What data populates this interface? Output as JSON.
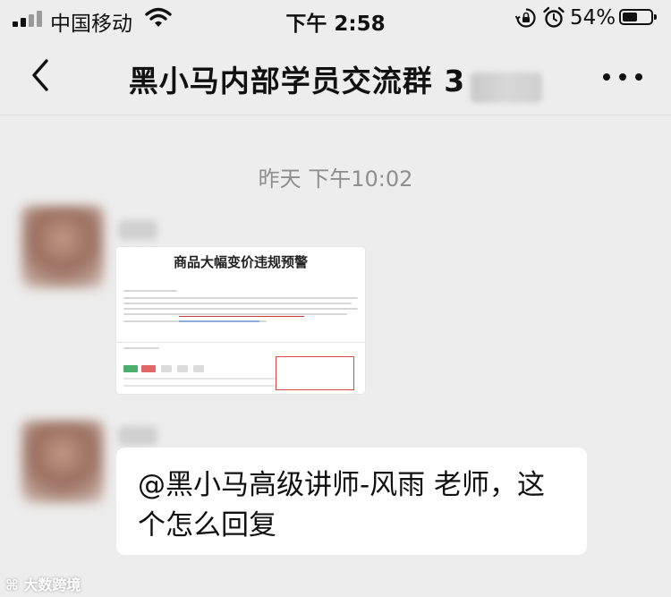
{
  "status_bar": {
    "carrier": "中国移动",
    "time": "下午 2:58",
    "battery_percent": "54%",
    "battery_level": 0.54,
    "icons": [
      "signal-icon",
      "wifi-icon",
      "rotation-lock-icon",
      "alarm-icon",
      "battery-icon"
    ]
  },
  "nav": {
    "title": "黑小马内部学员交流群 3",
    "back_icon": "chevron-left-icon",
    "more_icon": "more-horizontal-icon"
  },
  "chat": {
    "timestamp": "昨天 下午10:02",
    "messages": [
      {
        "type": "image",
        "preview": {
          "title": "商品大幅变价违规预警"
        }
      },
      {
        "type": "text",
        "text": "@黑小马高级讲师-风雨 老师，这个怎么回复"
      }
    ]
  },
  "watermark": "大数跨境",
  "colors": {
    "background": "#ededed",
    "bubble": "#ffffff",
    "timestamp": "#8e8e8e",
    "highlight_red": "#d94a4a"
  }
}
